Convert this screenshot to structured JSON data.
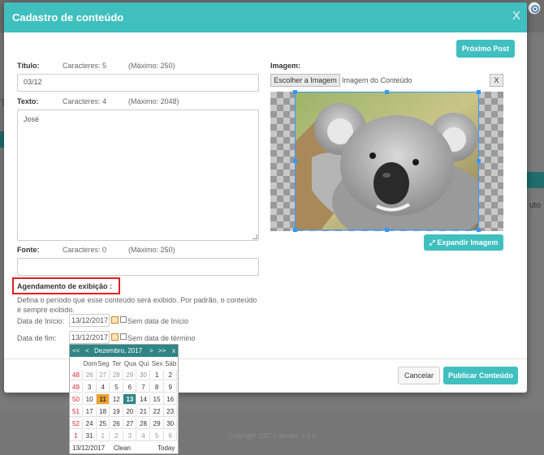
{
  "modal": {
    "title": "Cadastro de conteúdo",
    "close": "X",
    "next_post": "Próximo Post"
  },
  "titulo": {
    "label": "Título:",
    "chars": "Caracteres: 5",
    "max": "(Máximo: 250)",
    "value": "03/12"
  },
  "texto": {
    "label": "Texto:",
    "chars": "Caracteres: 4",
    "max": "(Máximo: 2048)",
    "value": "José"
  },
  "fonte": {
    "label": "Fonte:",
    "chars": "Caracteres: 0",
    "max": "(Máximo: 250)",
    "value": ""
  },
  "imagem": {
    "label": "Imagem:",
    "choose": "Escolher a Imagem",
    "filename": "Imagem do Conteúdo",
    "remove": "X",
    "expand": "Expandir Imagem",
    "expand_icon": "expand-arrows-icon"
  },
  "agendamento": {
    "title": "Agendamento de exibição :",
    "description": "Defina o período que esse conteúdo será exibido. Por padrão, o conteúdo é sempre exibido.",
    "start_label": "Data de Início:",
    "start_value": "13/12/2017",
    "start_checkbox": "Sem data de Início",
    "end_label": "Data de fim:",
    "end_value": "13/12/2017",
    "end_checkbox": "Sem data de término"
  },
  "footer": {
    "cancel": "Cancelar",
    "publish": "Publicar Conteúdo"
  },
  "calendar": {
    "prev_year": "<<",
    "prev_month": "<",
    "month_year": "Dezembro, 2017",
    "next_month": ">",
    "next_year": ">>",
    "close": "x",
    "weekdays": [
      "Dom",
      "Seg",
      "Ter",
      "Qua",
      "Qui",
      "Sex",
      "Sáb"
    ],
    "weeks": [
      {
        "week": "48",
        "days": [
          "26",
          "27",
          "28",
          "29",
          "30",
          "1",
          "2"
        ]
      },
      {
        "week": "49",
        "days": [
          "3",
          "4",
          "5",
          "6",
          "7",
          "8",
          "9"
        ]
      },
      {
        "week": "50",
        "days": [
          "10",
          "11",
          "12",
          "13",
          "14",
          "15",
          "16"
        ]
      },
      {
        "week": "51",
        "days": [
          "17",
          "18",
          "19",
          "20",
          "21",
          "22",
          "23"
        ]
      },
      {
        "week": "52",
        "days": [
          "24",
          "25",
          "26",
          "27",
          "28",
          "29",
          "30"
        ]
      },
      {
        "week": "1",
        "days": [
          "31",
          "1",
          "2",
          "3",
          "4",
          "5",
          "6"
        ]
      }
    ],
    "today_date": "11",
    "selected_date": "13",
    "footer_date": "13/12/2017",
    "clean": "Clean",
    "today": "Today"
  },
  "background": {
    "copyright": "Copyright 2017 | Versão: 2.9.0",
    "left_fragment": "Te",
    "right_fragment": "uto"
  },
  "colors": {
    "accent": "#40bfbf",
    "calendar_header": "#2f8585",
    "highlight_border": "#e02020",
    "today_bg": "#f0a22a"
  }
}
